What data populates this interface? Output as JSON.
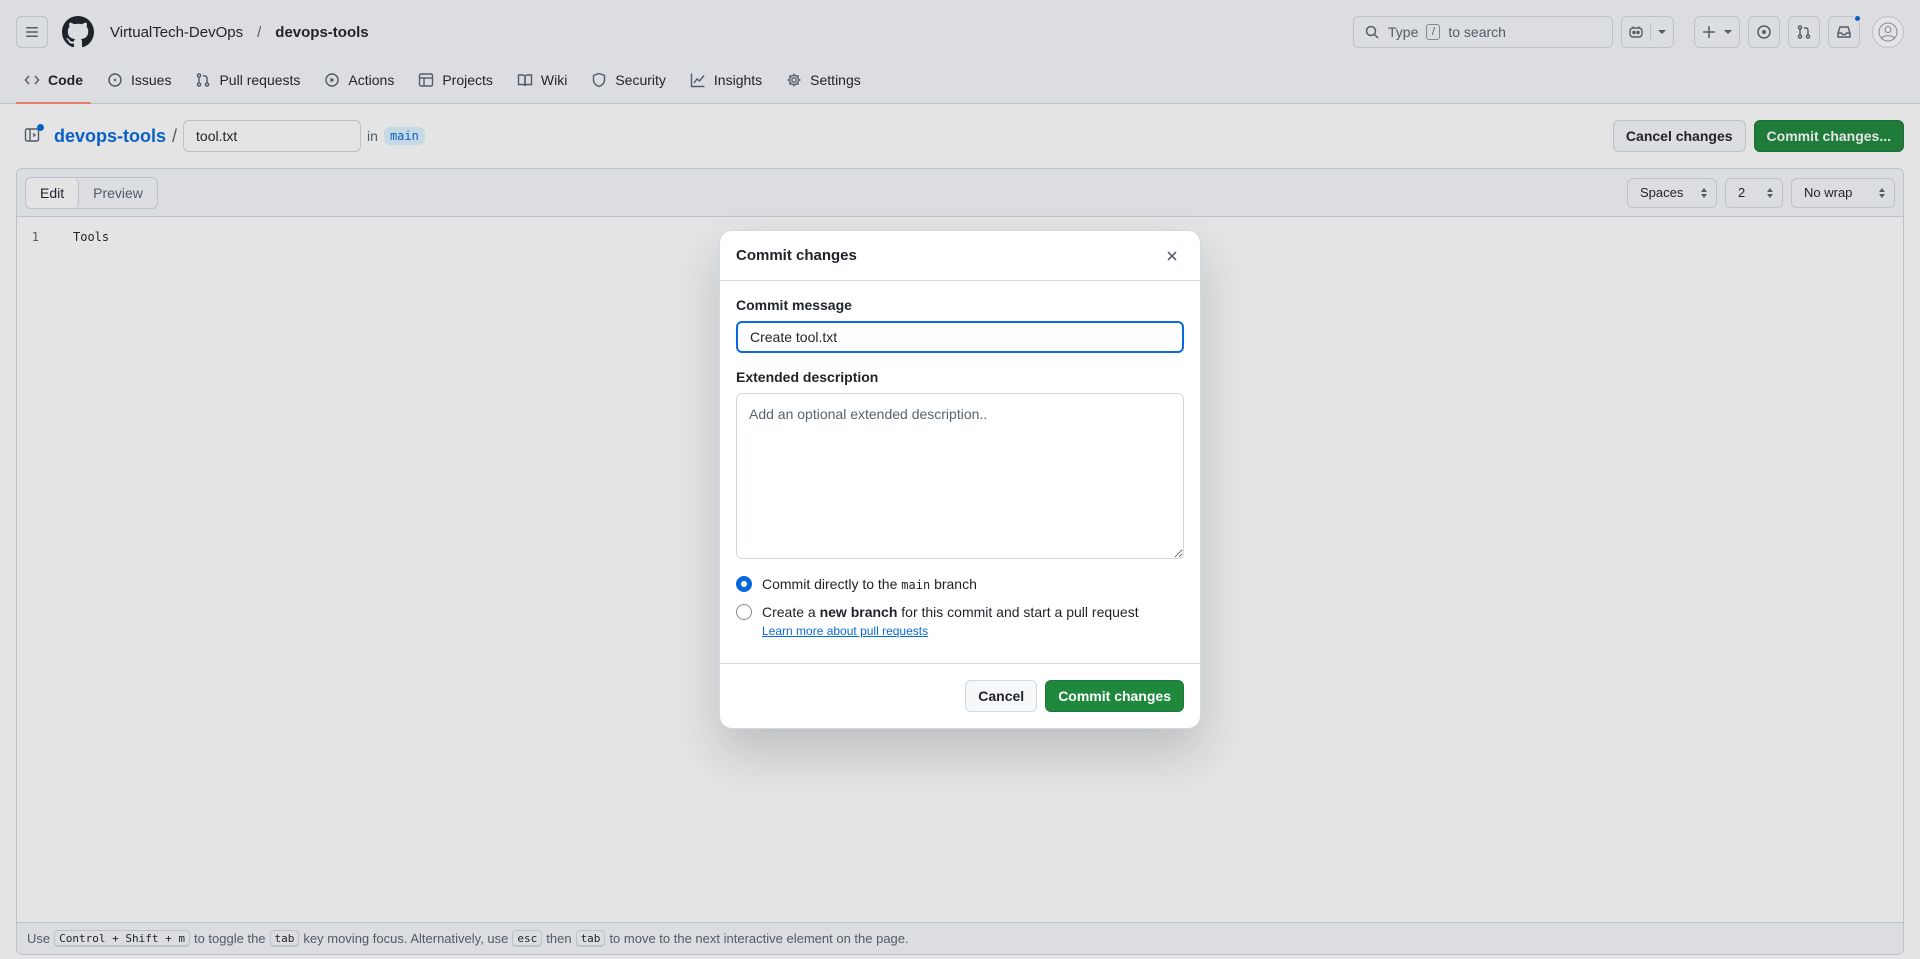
{
  "header": {
    "owner": "VirtualTech-DevOps",
    "separator": "/",
    "repo": "devops-tools",
    "search_prefix": "Type",
    "search_key": "/",
    "search_suffix": "to search"
  },
  "nav": {
    "items": [
      {
        "label": "Code",
        "icon": "code-icon",
        "active": true
      },
      {
        "label": "Issues",
        "icon": "issue-icon"
      },
      {
        "label": "Pull requests",
        "icon": "pull-request-icon"
      },
      {
        "label": "Actions",
        "icon": "play-icon"
      },
      {
        "label": "Projects",
        "icon": "table-icon"
      },
      {
        "label": "Wiki",
        "icon": "book-icon"
      },
      {
        "label": "Security",
        "icon": "shield-icon"
      },
      {
        "label": "Insights",
        "icon": "graph-icon"
      },
      {
        "label": "Settings",
        "icon": "gear-icon"
      }
    ]
  },
  "filebar": {
    "repo_link": "devops-tools",
    "slash": "/",
    "filename": "tool.txt",
    "in_label": "in",
    "branch": "main",
    "cancel_label": "Cancel changes",
    "commit_label": "Commit changes..."
  },
  "editor": {
    "tab_edit": "Edit",
    "tab_preview": "Preview",
    "indent_mode": "Spaces",
    "indent_size": "2",
    "wrap_mode": "No wrap",
    "lines": [
      {
        "no": "1",
        "text": "Tools"
      }
    ]
  },
  "status": {
    "use": "Use",
    "k1": "Control + Shift + m",
    "t1": "to toggle the",
    "k2": "tab",
    "t2": "key moving focus. Alternatively, use",
    "k3": "esc",
    "t3": "then",
    "k4": "tab",
    "t4": "to move to the next interactive element on the page."
  },
  "dialog": {
    "title": "Commit changes",
    "message_label": "Commit message",
    "message_value": "Create tool.txt",
    "description_label": "Extended description",
    "description_placeholder": "Add an optional extended description..",
    "option1_prefix": "Commit directly to the",
    "option1_branch": "main",
    "option1_suffix": "branch",
    "option2_prefix": "Create a",
    "option2_bold": "new branch",
    "option2_suffix": "for this commit and start a pull request",
    "learn_more": "Learn more about pull requests",
    "cancel_label": "Cancel",
    "commit_label": "Commit changes"
  },
  "colors": {
    "accent": "#0969da",
    "primary_button": "#1f883d",
    "active_tab_underline": "#fd8c73"
  }
}
